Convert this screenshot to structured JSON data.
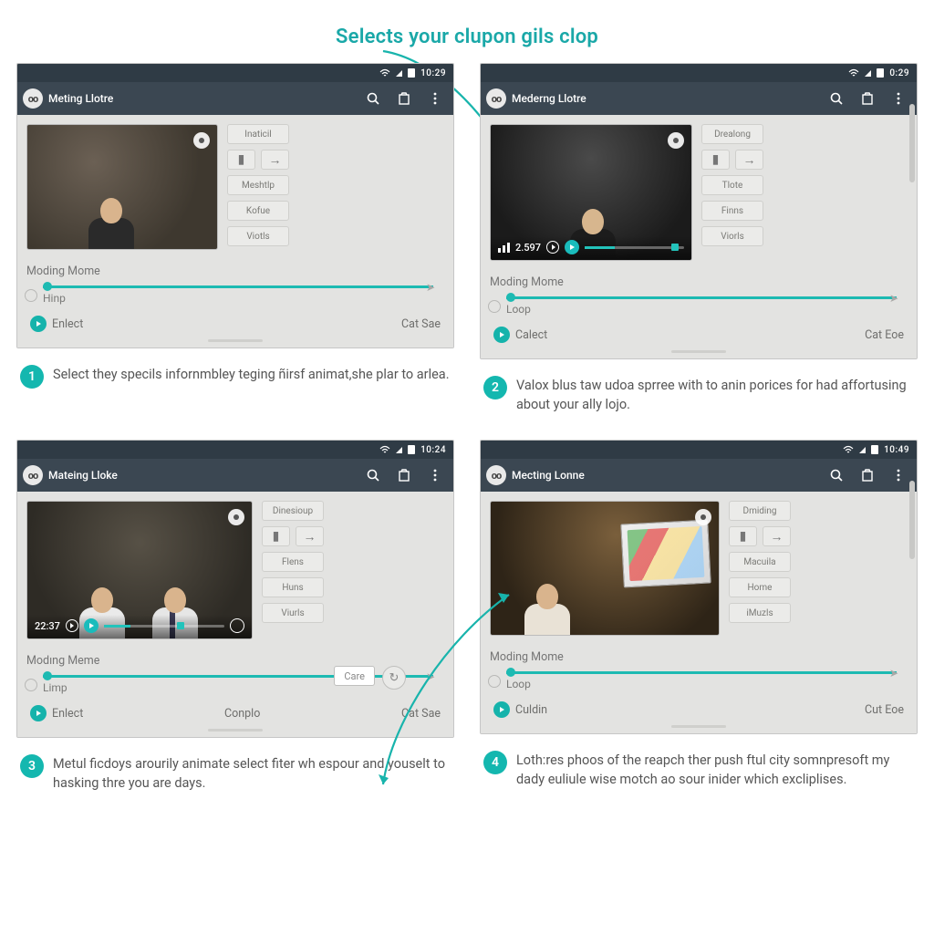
{
  "page_title": "Selects your clupon gils clop",
  "accent": "#14b7af",
  "panels": [
    {
      "status_time": "10:29",
      "app_title": "Meting Llotre",
      "side_top": "Inaticil",
      "side_items": [
        "Meshtlp",
        "Kofue",
        "Viotls"
      ],
      "section": "Moding Mome",
      "sublabel": "Hinp",
      "left_action": "Enlect",
      "center_action": "",
      "right_action": "Cat Sae",
      "overlay": {
        "show": false,
        "time": ""
      }
    },
    {
      "status_time": "0:29",
      "app_title": "Mederng Llotre",
      "side_top": "Drealong",
      "side_items": [
        "Tlote",
        "Finns",
        "Viorls"
      ],
      "section": "Moding Mome",
      "sublabel": "Loop",
      "left_action": "Calect",
      "center_action": "",
      "right_action": "Cat Eoe",
      "overlay": {
        "show": true,
        "time": "2.597"
      }
    },
    {
      "status_time": "10:24",
      "app_title": "Mateing Lloke",
      "side_top": "Dinesioup",
      "side_items": [
        "Flens",
        "Huns",
        "Viurls"
      ],
      "section": "Modıng Meme",
      "sublabel": "Limp",
      "left_action": "Enlect",
      "center_action": "Conplo",
      "right_action": "Cat Sae",
      "overlay": {
        "show": true,
        "time": "22:37"
      },
      "inline_input": "Care"
    },
    {
      "status_time": "10:49",
      "app_title": "Mecting Lonne",
      "side_top": "Dmiding",
      "side_items": [
        "Macuila",
        "Home",
        "iMuzls"
      ],
      "section": "Moding Mome",
      "sublabel": "Loop",
      "left_action": "Culdin",
      "center_action": "",
      "right_action": "Cut Eoe",
      "overlay": {
        "show": false,
        "time": ""
      }
    }
  ],
  "steps": [
    "Select they specils infornmbley teging ñirsf animat,she plar to arlea.",
    "Valox blus taw udoa sprree with to anin porices for had affortusing about your ally lojo.",
    "Metul ficdoys arourily animate select fiter wh espour and youselt to hasking thre you are days.",
    "Loth:res phoos of the reapch ther push ftul city somnpresoft my dady euliule wise motch ao sour inider which excliplises."
  ]
}
